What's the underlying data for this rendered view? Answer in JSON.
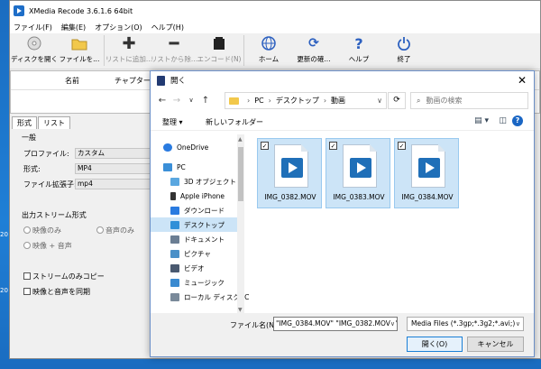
{
  "desktop": {
    "labels": [
      "20",
      "20"
    ]
  },
  "app": {
    "title": "XMedia Recode 3.6.1.6 64bit",
    "menu": [
      "ファイル(F)",
      "編集(E)",
      "オプション(O)",
      "ヘルプ(H)"
    ],
    "toolbar": [
      {
        "label": "ディスクを開く",
        "icon": "disc-icon"
      },
      {
        "label": "ファイルを...",
        "icon": "folder-icon"
      },
      {
        "label": "リストに追加...",
        "icon": "plus-icon"
      },
      {
        "label": "リストから除...",
        "icon": "minus-icon"
      },
      {
        "label": "エンコード(N)",
        "icon": "encode-icon"
      },
      {
        "label": "ホーム",
        "icon": "globe-icon"
      },
      {
        "label": "更新の確...",
        "icon": "refresh-icon"
      },
      {
        "label": "ヘルプ",
        "icon": "help-icon"
      },
      {
        "label": "終了",
        "icon": "power-icon"
      }
    ],
    "list_headers": [
      "名前",
      "チャプター"
    ],
    "tabs": [
      "形式",
      "リスト"
    ],
    "section_general": "一般",
    "profile_label": "プロファイル:",
    "profile_value": "カスタム",
    "format_label": "形式:",
    "format_value": "MP4",
    "ext_label": "ファイル拡張子:",
    "ext_value": "mp4",
    "output_stream_label": "出力ストリーム形式",
    "radio_video_only": "映像のみ",
    "radio_audio_only": "音声のみ",
    "radio_video_audio": "映像 + 音声",
    "chk_stream_copy": "ストリームのみコピー",
    "chk_sync": "映像と音声を同期"
  },
  "dialog": {
    "title": "開く",
    "breadcrumb": [
      "PC",
      "デスクトップ",
      "動画"
    ],
    "search_placeholder": "動画の検索",
    "organize": "整理 ▾",
    "new_folder": "新しいフォルダー",
    "nav": [
      {
        "label": "OneDrive",
        "icon": "cloud-icon",
        "color": "#2a7be0"
      },
      {
        "label": "PC",
        "icon": "pc-icon",
        "color": "#3b8fd8"
      },
      {
        "label": "3D オブジェクト",
        "icon": "cube-icon",
        "color": "#5aa7e0"
      },
      {
        "label": "Apple iPhone",
        "icon": "phone-icon",
        "color": "#333333"
      },
      {
        "label": "ダウンロード",
        "icon": "download-icon",
        "color": "#2a7be0"
      },
      {
        "label": "デスクトップ",
        "icon": "desktop-icon",
        "color": "#2f8fd8"
      },
      {
        "label": "ドキュメント",
        "icon": "document-icon",
        "color": "#6b7e93"
      },
      {
        "label": "ピクチャ",
        "icon": "picture-icon",
        "color": "#4a90c8"
      },
      {
        "label": "ビデオ",
        "icon": "video-icon",
        "color": "#4a5a70"
      },
      {
        "label": "ミュージック",
        "icon": "music-icon",
        "color": "#3a8ad0"
      },
      {
        "label": "ローカル ディスク (C",
        "icon": "disk-icon",
        "color": "#7a8a9a"
      }
    ],
    "files": [
      "IMG_0382.MOV",
      "IMG_0383.MOV",
      "IMG_0384.MOV"
    ],
    "filename_label": "ファイル名(N):",
    "filename_value": "\"IMG_0384.MOV\" \"IMG_0382.MOV\" \"",
    "filetype_value": "Media Files (*.3gp;*.3g2;*.avi;)",
    "open_label": "開く(O)",
    "cancel_label": "キャンセル"
  }
}
